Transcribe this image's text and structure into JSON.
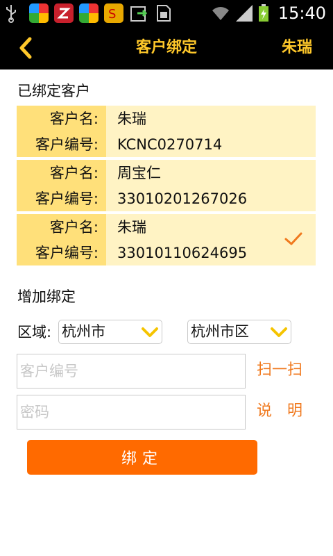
{
  "status_bar": {
    "time": "15:40",
    "icons": [
      "usb-icon",
      "app-icon",
      "app-icon",
      "app-icon",
      "app-icon",
      "app-icon",
      "sim-icon",
      "wifi-icon",
      "signal-icon",
      "battery-charging-icon"
    ]
  },
  "header": {
    "back_icon": "chevron-left-icon",
    "title": "客户绑定",
    "user": "朱瑞",
    "accent_color": "#ffc82a"
  },
  "bound": {
    "title": "已绑定客户",
    "name_label": "客户名:",
    "number_label": "客户编号:",
    "items": [
      {
        "name": "朱瑞",
        "number": "KCNC0270714",
        "selected": false
      },
      {
        "name": "周宝仁",
        "number": "33010201267026",
        "selected": false
      },
      {
        "name": "朱瑞",
        "number": "33010110624695",
        "selected": true
      }
    ]
  },
  "add": {
    "title": "增加绑定",
    "region_label": "区域:",
    "city": "杭州市",
    "district": "杭州市区",
    "customer_number_placeholder": "客户编号",
    "password_placeholder": "密码",
    "scan_label": "扫一扫",
    "explain_label": "说　明",
    "submit_label": "绑定",
    "button_color": "#ff6a00"
  }
}
